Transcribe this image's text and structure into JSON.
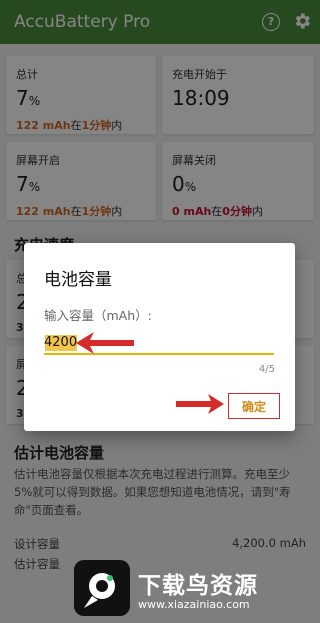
{
  "app": {
    "title": "AccuBattery Pro",
    "help_glyph": "?"
  },
  "cards": [
    {
      "label": "总计",
      "value": "7",
      "unit": "%",
      "amount": "122 mAh",
      "in": "在",
      "time": "1分钟",
      "suffix": "内"
    },
    {
      "label": "充电开始于",
      "value": "18:09"
    },
    {
      "label": "屏幕开启",
      "value": "7",
      "unit": "%",
      "amount": "122 mAh",
      "in": "在",
      "time": "1分钟",
      "suffix": "内"
    },
    {
      "label": "屏幕关闭",
      "value": "0",
      "unit": "%",
      "amount": "0 mAh",
      "in": "在",
      "time": "0分钟",
      "suffix": "内"
    }
  ],
  "charge_speed": {
    "title": "充电速度",
    "left_labels": [
      "总",
      "屏"
    ],
    "left_values": [
      "2",
      "2"
    ],
    "left_subs": [
      "3,",
      "3,"
    ]
  },
  "estimate": {
    "title": "估计电池容量",
    "description": "估计电池容量仅根据本次充电过程进行测算。充电至少5%就可以得到数据。如果您想知道电池情况，请到\"寿命\"页面查看。",
    "rows": [
      {
        "label": "设计容量",
        "value": "4,200.0 mAh"
      },
      {
        "label": "估计容量",
        "value": ""
      }
    ]
  },
  "dialog": {
    "title": "电池容量",
    "prompt": "输入容量（mAh）:",
    "value": "4200",
    "counter": "4/5",
    "ok": "确定"
  },
  "watermark": {
    "name": "下载鸟资源",
    "url": "www.xiazainiao.com"
  },
  "colors": {
    "appbar": "#4a8d3c",
    "accent": "#e5b400",
    "annotation": "#d62b2b"
  }
}
